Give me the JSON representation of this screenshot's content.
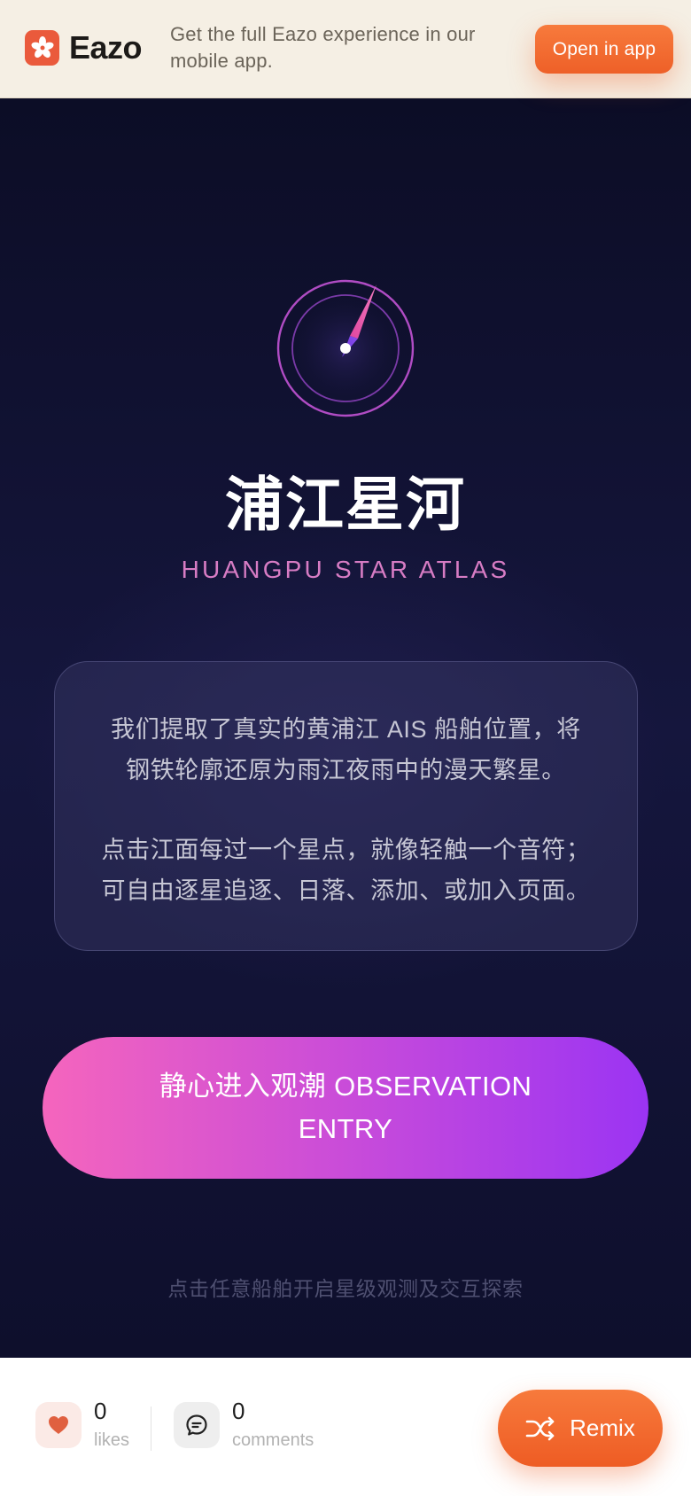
{
  "banner": {
    "brand_name": "Eazo",
    "brand_icon": "asterisk-flower-logo",
    "message": "Get the full Eazo experience in our mobile app.",
    "open_button": "Open in app"
  },
  "hero": {
    "icon": "compass-icon",
    "title": "浦江星河",
    "subtitle": "HUANGPU STAR ATLAS"
  },
  "intro_card": {
    "paragraph_1": "我们提取了真实的黄浦江 AIS 船舶位置，将钢铁轮廓还原为雨江夜雨中的漫天繁星。",
    "paragraph_2": "点击江面每过一个星点，就像轻触一个音符；可自由逐星追逐、日落、添加、或加入页面。"
  },
  "cta": {
    "label": "静心进入观潮 OBSERVATION ENTRY"
  },
  "hint": "点击任意船舶开启星级观测及交互探索",
  "bottom_bar": {
    "likes_count": "0",
    "likes_label": "likes",
    "comments_count": "0",
    "comments_label": "comments",
    "remix_label": "Remix"
  },
  "colors": {
    "brand_orange": "#ee6028",
    "background_navy": "#0c0d26",
    "subtitle_pink": "#d77cc4",
    "cta_gradient_start": "#f565bd",
    "cta_gradient_end": "#9b34f3"
  }
}
